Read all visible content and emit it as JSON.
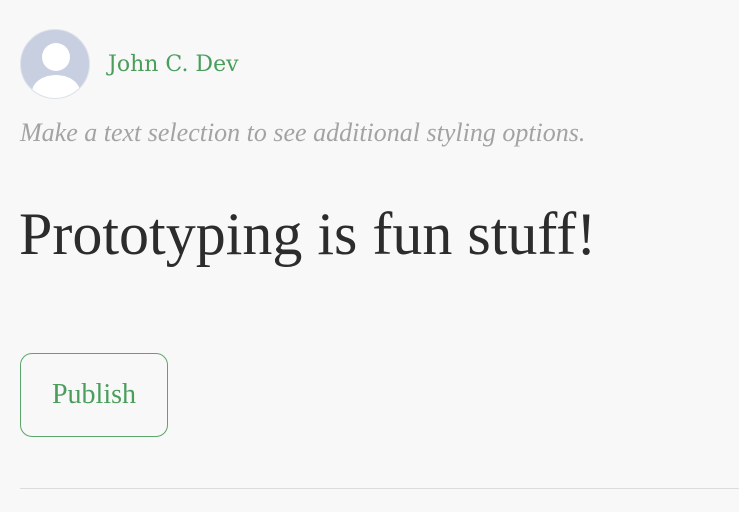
{
  "author": {
    "name": "John C. Dev",
    "avatar_icon": "user-avatar-icon"
  },
  "editor": {
    "hint": "Make a text selection to see additional styling options.",
    "title": "Prototyping is fun stuff!"
  },
  "actions": {
    "publish_label": "Publish"
  },
  "colors": {
    "accent": "#4a9e5c",
    "hint": "#a3a3a3",
    "title": "#2c2c2c",
    "background": "#f8f8f8"
  }
}
